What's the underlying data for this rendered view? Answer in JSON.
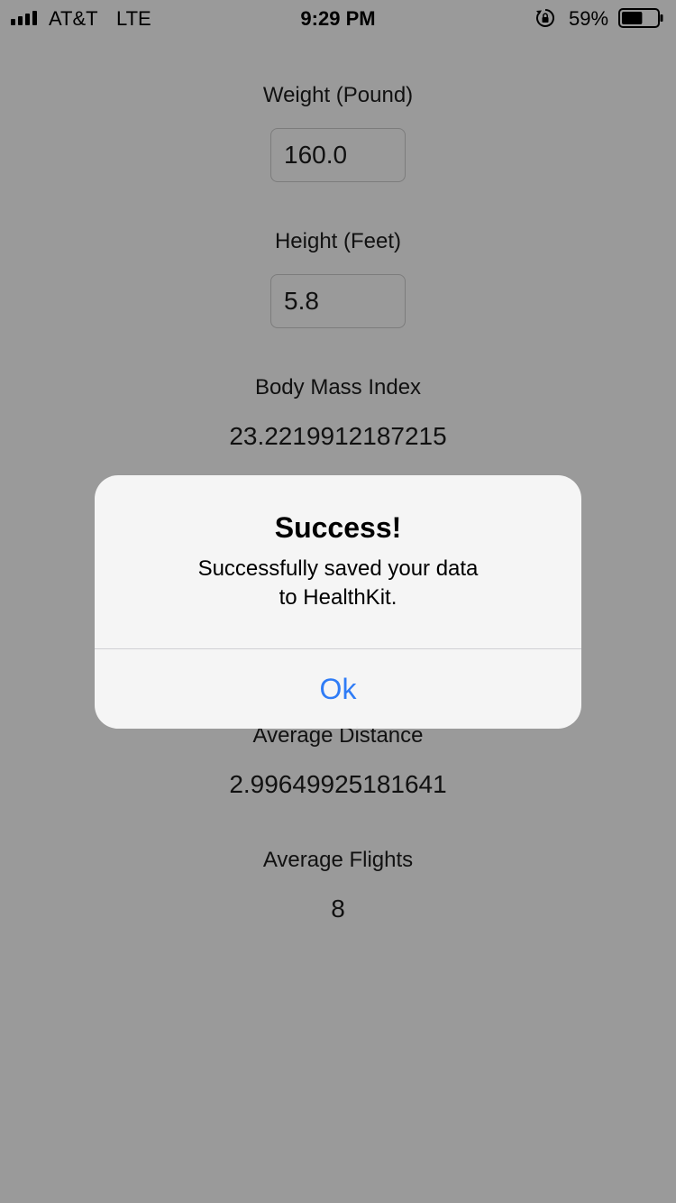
{
  "status_bar": {
    "carrier": "AT&T",
    "network": "LTE",
    "time": "9:29 PM",
    "battery_percent": "59%",
    "battery_level": 0.59
  },
  "form": {
    "weight_label": "Weight (Pound)",
    "weight_value": "160.0",
    "height_label": "Height (Feet)",
    "height_value": "5.8"
  },
  "stats": {
    "bmi_label": "Body Mass Index",
    "bmi_value": "23.2219912187215",
    "distance_label": "Average Distance",
    "distance_value": "2.99649925181641",
    "flights_label": "Average Flights",
    "flights_value": "8"
  },
  "alert": {
    "title": "Success!",
    "message_line1": "Successfully saved your data",
    "message_line2": "to HealthKit.",
    "ok_label": "Ok"
  },
  "colors": {
    "dimmed_background": "#9a9a9a",
    "alert_button": "#2f7cf6"
  },
  "icons": {
    "signal": "signal-bars-icon",
    "orientation_lock": "orientation-lock-icon",
    "battery": "battery-icon"
  }
}
